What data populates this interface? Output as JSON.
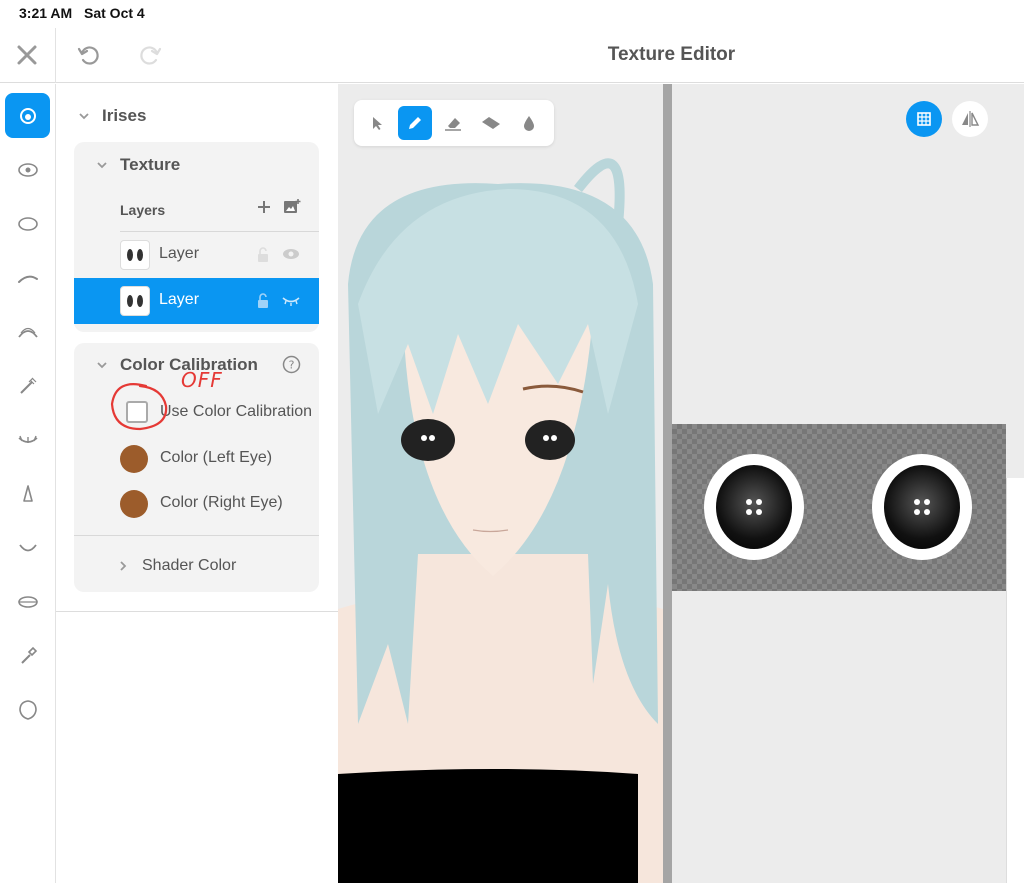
{
  "status_bar": {
    "time": "3:21 AM",
    "date": "Sat Oct 4"
  },
  "header": {
    "title": "Texture Editor",
    "close_icon": "close-icon",
    "undo_icon": "undo-icon",
    "redo_icon": "redo-icon"
  },
  "rail": {
    "items": [
      "eye-icon",
      "eye-white-icon",
      "eye-outline-icon",
      "eyebrow-icon",
      "eyelash-icon",
      "mascara-icon",
      "lower-lash-icon",
      "nose-icon",
      "mouth-icon",
      "lips-icon",
      "brush-icon",
      "face-icon"
    ],
    "active_index": 0
  },
  "panel": {
    "section_title": "Irises",
    "texture": {
      "title": "Texture",
      "layers_label": "Layers",
      "layers": [
        {
          "name": "Layer",
          "selected": false
        },
        {
          "name": "Layer",
          "selected": true
        }
      ]
    },
    "color_calibration": {
      "title": "Color Calibration",
      "checkbox_label": "Use Color Calibration",
      "checkbox_checked": false,
      "left_eye_label": "Color (Left Eye)",
      "right_eye_label": "Color (Right Eye)",
      "left_eye_color": "#9c5c2b",
      "right_eye_color": "#9c5c2b",
      "shader_color_label": "Shader Color"
    },
    "annotation": "OFF"
  },
  "viewport_tools": [
    "select-icon",
    "pencil-icon",
    "eraser-icon",
    "fill-icon",
    "dropper-icon"
  ],
  "accent_color": "#0a96f2"
}
